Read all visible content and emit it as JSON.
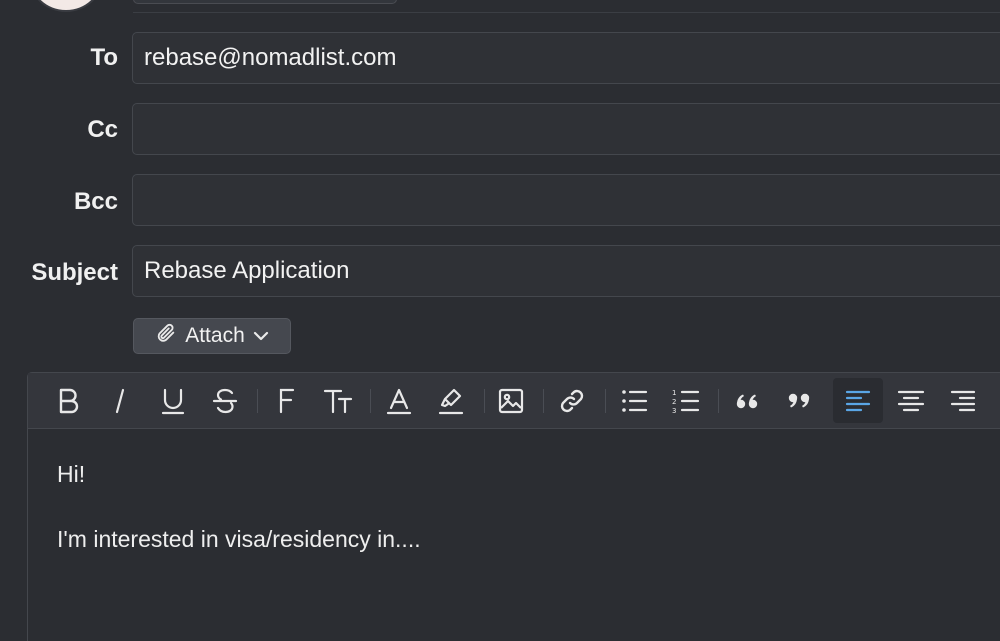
{
  "compose": {
    "to": {
      "label": "To",
      "value": "rebase@nomadlist.com"
    },
    "cc": {
      "label": "Cc",
      "value": ""
    },
    "bcc": {
      "label": "Bcc",
      "value": ""
    },
    "subject": {
      "label": "Subject",
      "value": "Rebase Application"
    }
  },
  "attach": {
    "label": "Attach"
  },
  "toolbar": {
    "items": [
      "bold",
      "italic",
      "underline",
      "strikethrough",
      "font",
      "text-size",
      "text-color",
      "highlight",
      "image",
      "link",
      "bulleted-list",
      "numbered-list",
      "quote-open",
      "quote-close",
      "align-left",
      "align-center",
      "align-right"
    ],
    "active": "align-left",
    "accent": "#5aa6e6"
  },
  "body": {
    "lines": [
      "Hi!",
      "I'm interested in visa/residency in...."
    ]
  }
}
